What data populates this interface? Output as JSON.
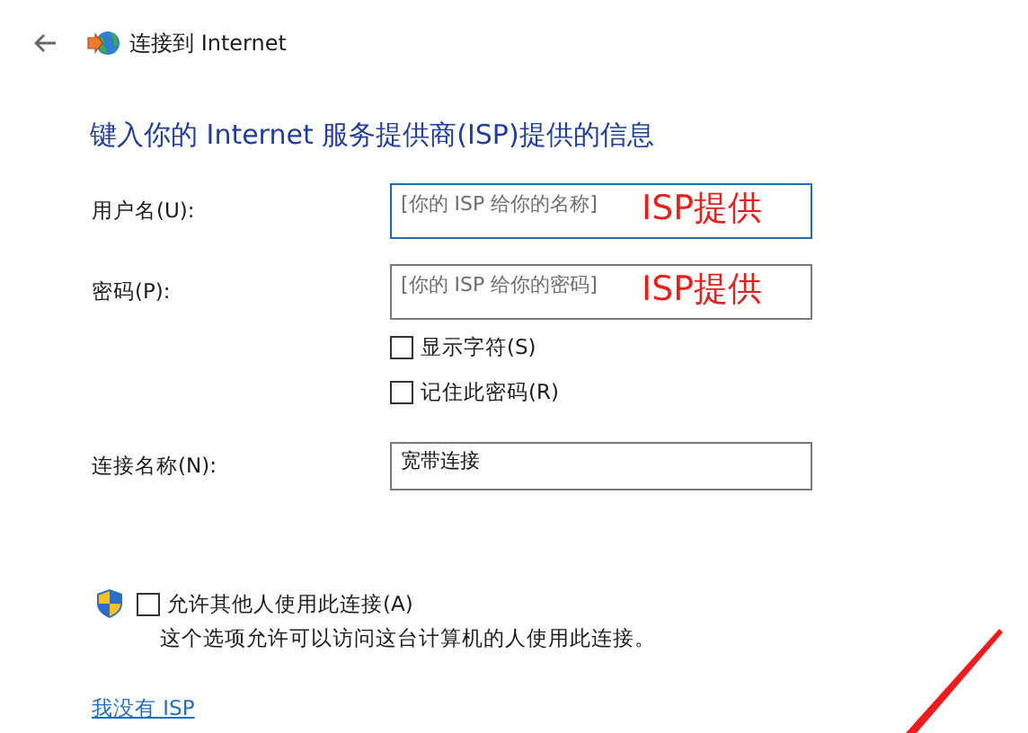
{
  "header": {
    "title": "连接到 Internet"
  },
  "heading": "键入你的 Internet 服务提供商(ISP)提供的信息",
  "fields": [
    {
      "label": "用户名(U):",
      "placeholder": "[你的 ISP 给你的名称]",
      "focused": true,
      "annotation": "ISP提供"
    },
    {
      "label": "密码(P):",
      "placeholder": "[你的 ISP 给你的密码]",
      "focused": false,
      "annotation": "ISP提供"
    }
  ],
  "options": [
    {
      "label": "显示字符(S)",
      "checked": false
    },
    {
      "label": "记住此密码(R)",
      "checked": false
    }
  ],
  "connection_name": {
    "label": "连接名称(N):",
    "value": "宽带连接"
  },
  "sharing": {
    "label": "允许其他人使用此连接(A)",
    "checked": false,
    "description": "这个选项允许可以访问这台计算机的人使用此连接。"
  },
  "link": "我没有 ISP"
}
